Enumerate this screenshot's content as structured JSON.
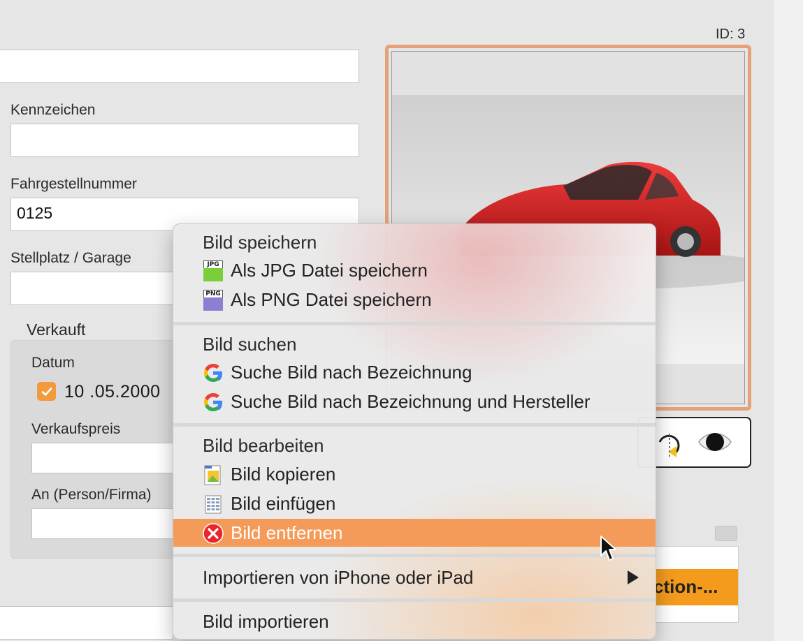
{
  "record": {
    "id_label": "ID: 3"
  },
  "form": {
    "kennzeichen": {
      "label": "Kennzeichen",
      "value": ""
    },
    "fahrgestellnummer": {
      "label": "Fahrgestellnummer",
      "value": "0125"
    },
    "stellplatz": {
      "label": "Stellplatz / Garage",
      "value": ""
    },
    "verkauft": {
      "title": "Verkauft",
      "datum_label": "Datum",
      "datum_checked": true,
      "datum_value": "10 .05.2000",
      "verkaufspreis_label": "Verkaufspreis",
      "verkaufspreis_value": "",
      "an_label": "An (Person/Firma)",
      "an_value": ""
    }
  },
  "table": {
    "row_text": "ction-..."
  },
  "context_menu": {
    "sections": [
      {
        "header": "Bild speichern",
        "items": [
          {
            "label": "Als JPG Datei speichern",
            "icon": "jpg-file-icon",
            "icon_tag": "JPG",
            "color": "#7ccd3a"
          },
          {
            "label": "Als PNG Datei speichern",
            "icon": "png-file-icon",
            "icon_tag": "PNG",
            "color": "#8a7fd0"
          }
        ]
      },
      {
        "header": "Bild suchen",
        "items": [
          {
            "label": "Suche Bild nach Bezeichnung",
            "icon": "google-icon"
          },
          {
            "label": "Suche Bild nach Bezeichnung und Hersteller",
            "icon": "google-icon"
          }
        ]
      },
      {
        "header": "Bild bearbeiten",
        "items": [
          {
            "label": "Bild kopieren",
            "icon": "copy-image-icon"
          },
          {
            "label": "Bild einfügen",
            "icon": "paste-image-icon"
          },
          {
            "label": "Bild entfernen",
            "icon": "remove-icon",
            "selected": true
          }
        ]
      }
    ],
    "import_device": "Importieren von iPhone oder iPad",
    "import_image": "Bild importieren",
    "selection_color": "#f59b5a"
  },
  "colors": {
    "image_frame": "#e5a27a",
    "checkbox": "#f29a3c",
    "table_highlight": "#f49b1e"
  }
}
